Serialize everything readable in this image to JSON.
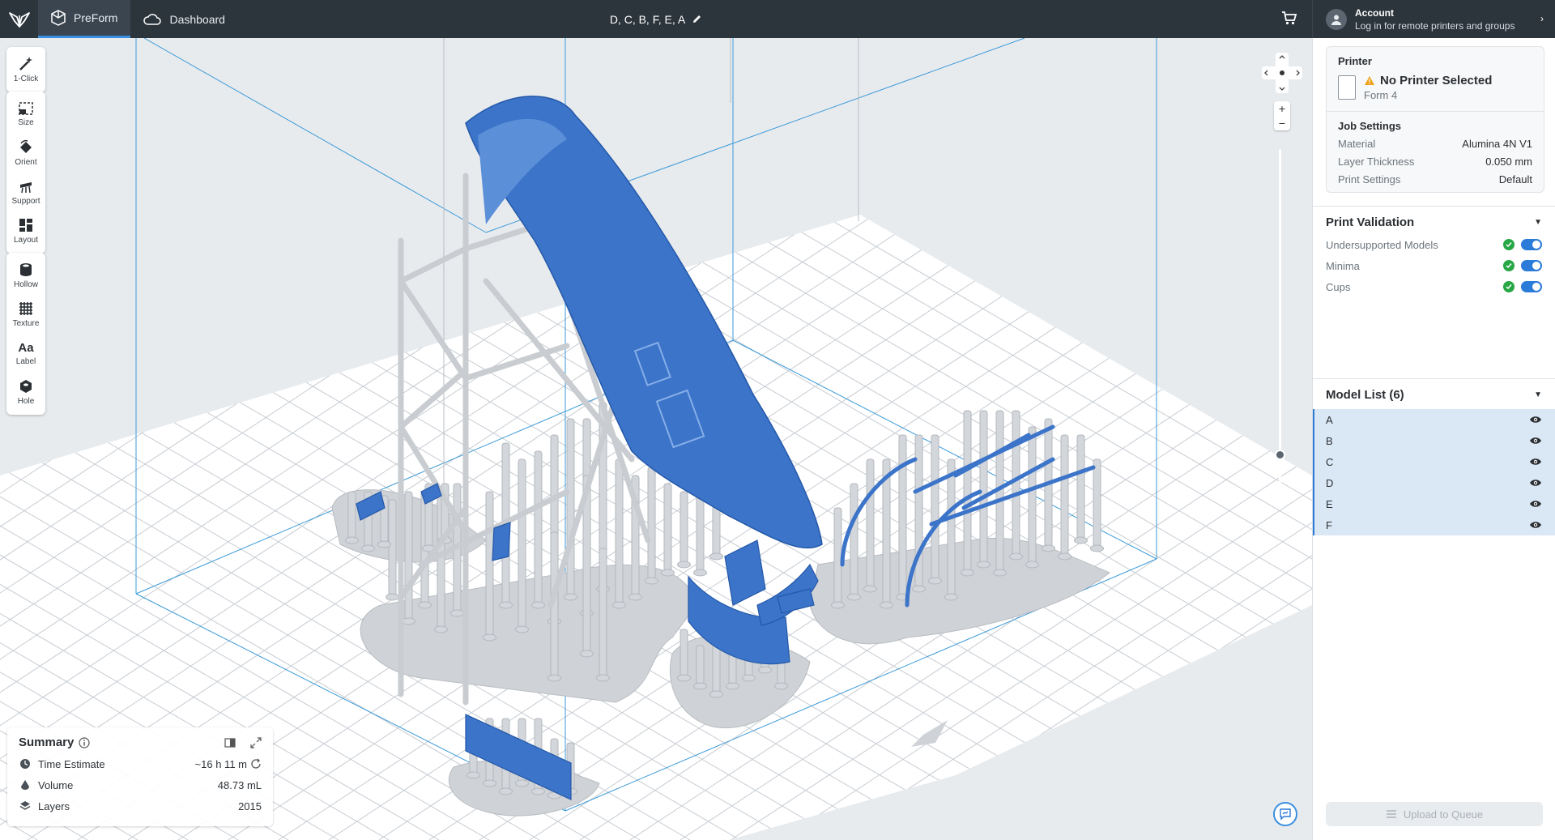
{
  "topbar": {
    "tabs": [
      {
        "label": "PreForm",
        "icon": "preform-icon",
        "active": true
      },
      {
        "label": "Dashboard",
        "icon": "cloud-icon",
        "active": false
      }
    ],
    "document_title": "D, C, B, F, E, A"
  },
  "account": {
    "title": "Account",
    "subtitle": "Log in for remote printers and groups"
  },
  "toolbar": {
    "groups": [
      [
        {
          "label": "1-Click",
          "icon": "magic-wand-icon"
        }
      ],
      [
        {
          "label": "Size",
          "icon": "size-icon"
        },
        {
          "label": "Orient",
          "icon": "orient-icon"
        },
        {
          "label": "Support",
          "icon": "support-icon"
        },
        {
          "label": "Layout",
          "icon": "layout-icon"
        }
      ],
      [
        {
          "label": "Hollow",
          "icon": "hollow-icon"
        },
        {
          "label": "Texture",
          "icon": "texture-icon"
        },
        {
          "label": "Label",
          "icon": "label-icon"
        },
        {
          "label": "Hole",
          "icon": "hole-icon"
        }
      ]
    ]
  },
  "summary": {
    "title": "Summary",
    "rows": [
      {
        "label": "Time Estimate",
        "value": "~16 h 11 m",
        "icon": "clock-icon"
      },
      {
        "label": "Volume",
        "value": "48.73 mL",
        "icon": "volume-icon"
      },
      {
        "label": "Layers",
        "value": "2015",
        "icon": "layers-icon"
      }
    ]
  },
  "printer": {
    "heading": "Printer",
    "name": "No Printer Selected",
    "model": "Form 4"
  },
  "job_settings": {
    "heading": "Job Settings",
    "rows": [
      {
        "key": "Material",
        "value": "Alumina 4N V1"
      },
      {
        "key": "Layer Thickness",
        "value": "0.050 mm"
      },
      {
        "key": "Print Settings",
        "value": "Default"
      }
    ]
  },
  "validation": {
    "heading": "Print Validation",
    "items": [
      "Undersupported Models",
      "Minima",
      "Cups"
    ]
  },
  "models": {
    "heading": "Model List (6)",
    "items": [
      "A",
      "B",
      "C",
      "D",
      "E",
      "F"
    ]
  },
  "upload_label": "Upload to Queue",
  "colors": {
    "topbar": "#2c343c",
    "accent": "#2b7bd8",
    "model_blue": "#3a72c8",
    "support_gray": "#c9ccd0",
    "selected_row": "#dae7f5"
  }
}
